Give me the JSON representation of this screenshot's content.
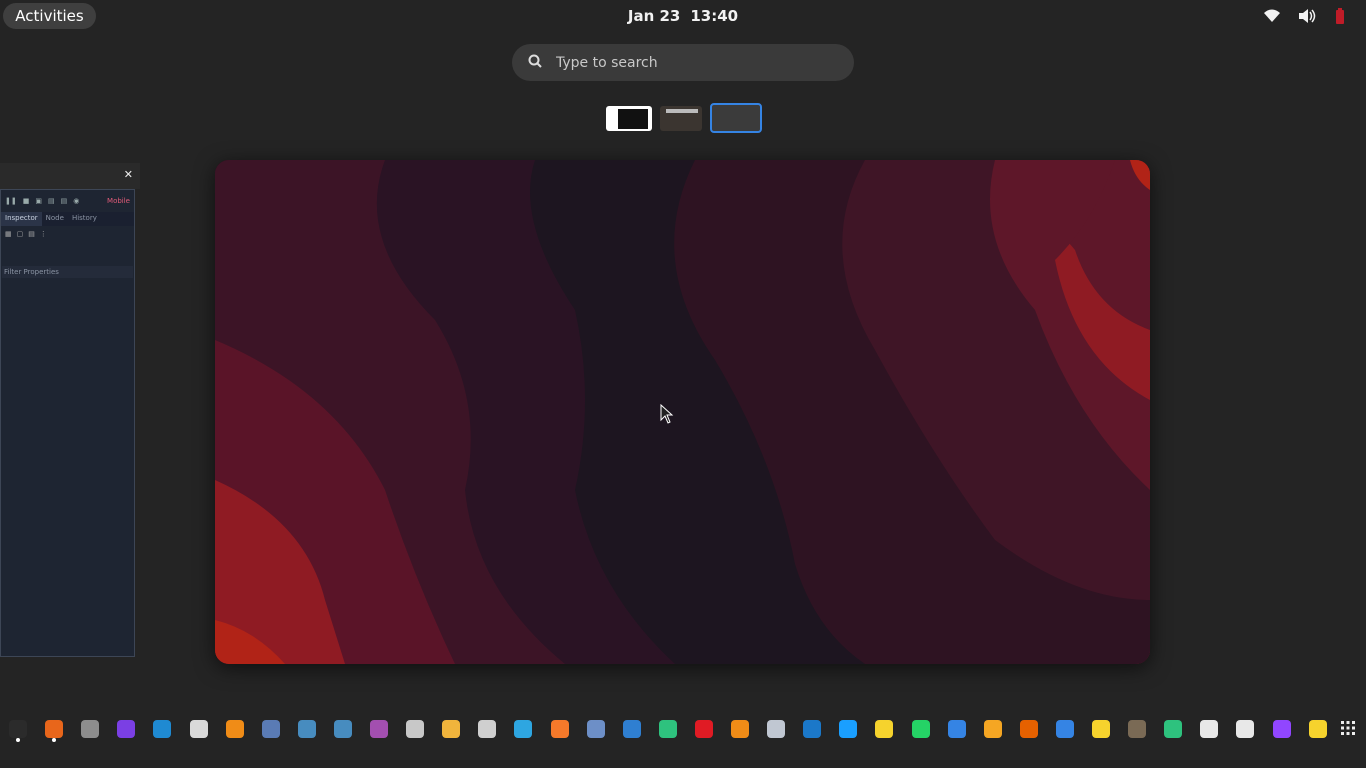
{
  "topbar": {
    "activities_label": "Activities",
    "date": "Jan 23",
    "time": "13:40",
    "tray_icons": [
      "wifi-icon",
      "volume-icon",
      "battery-icon"
    ]
  },
  "search": {
    "placeholder": "Type to search"
  },
  "workspaces": [
    {
      "name": "workspace-1",
      "active": false
    },
    {
      "name": "workspace-2",
      "active": false
    },
    {
      "name": "workspace-3",
      "active": true
    }
  ],
  "side_window": {
    "toolbar_dropdown": "Mobile",
    "tabs": [
      "Inspector",
      "Node",
      "History"
    ],
    "filter_placeholder": "Filter Properties"
  },
  "dock": {
    "apps": [
      {
        "name": "terminal-icon",
        "color": "#2b2b2b",
        "running": true
      },
      {
        "name": "firefox-icon",
        "color": "#e8661b",
        "running": true
      },
      {
        "name": "files-icon",
        "color": "#8d8d8d",
        "running": false
      },
      {
        "name": "app-purple-icon",
        "color": "#7b3fe4",
        "running": false
      },
      {
        "name": "vscode-icon",
        "color": "#1f8ad2",
        "running": false
      },
      {
        "name": "chromium-icon",
        "color": "#d9d9d9",
        "running": false
      },
      {
        "name": "archive-icon",
        "color": "#f08c17",
        "running": false
      },
      {
        "name": "scene-builder-icon",
        "color": "#5a7bb5",
        "running": false
      },
      {
        "name": "godot-icon",
        "color": "#478cbf",
        "running": false
      },
      {
        "name": "godot-mono-icon",
        "color": "#478cbf",
        "running": false
      },
      {
        "name": "app-orb-icon",
        "color": "#a34fb0",
        "running": false
      },
      {
        "name": "owl-icon",
        "color": "#c8c8c8",
        "running": false
      },
      {
        "name": "color-picker-icon",
        "color": "#f0b43c",
        "running": false
      },
      {
        "name": "inkscape-icon",
        "color": "#cfcfcf",
        "running": false
      },
      {
        "name": "telegram-icon",
        "color": "#2ea6e1",
        "running": false
      },
      {
        "name": "blender-icon",
        "color": "#f5792a",
        "running": false
      },
      {
        "name": "network-icon",
        "color": "#6d8fc7",
        "running": false
      },
      {
        "name": "screenshot-icon",
        "color": "#2f7fd1",
        "running": false
      },
      {
        "name": "headset-icon",
        "color": "#2ec27e",
        "running": false
      },
      {
        "name": "warning-app-icon",
        "color": "#e01b24",
        "running": false
      },
      {
        "name": "audio-app-icon",
        "color": "#f08c17",
        "running": false
      },
      {
        "name": "package-icon",
        "color": "#c0c7d2",
        "running": false
      },
      {
        "name": "musescore-icon",
        "color": "#1b78c9",
        "running": false
      },
      {
        "name": "steam-icon",
        "color": "#1a9fff",
        "running": false
      },
      {
        "name": "notes-icon",
        "color": "#f6d32d",
        "running": false
      },
      {
        "name": "whatsapp-icon",
        "color": "#25d366",
        "running": false
      },
      {
        "name": "calc-icon",
        "color": "#3584e4",
        "running": false
      },
      {
        "name": "compass-icon",
        "color": "#f5a623",
        "running": false
      },
      {
        "name": "color-wheel-icon",
        "color": "#e66100",
        "running": false
      },
      {
        "name": "mail-icon",
        "color": "#3584e4",
        "running": false
      },
      {
        "name": "weather-icon",
        "color": "#f6d32d",
        "running": false
      },
      {
        "name": "spreadsheet-icon",
        "color": "#7a6a55",
        "running": false
      },
      {
        "name": "system-monitor-icon",
        "color": "#2ec27e",
        "running": false
      },
      {
        "name": "calendar-icon",
        "color": "#e8e8e8",
        "running": false
      },
      {
        "name": "card-game-icon",
        "color": "#e8e8e8",
        "running": false
      },
      {
        "name": "twitch-icon",
        "color": "#9146ff",
        "running": false
      },
      {
        "name": "robot-arm-icon",
        "color": "#f6d32d",
        "running": false
      }
    ],
    "show_apps_icon": "grid-icon"
  }
}
